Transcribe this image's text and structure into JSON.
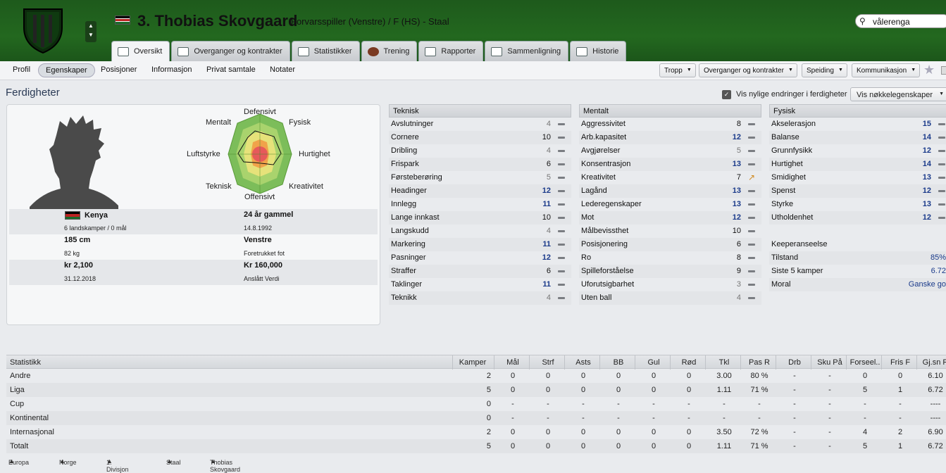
{
  "header": {
    "player_number_name": "3. Thobias Skovgaard",
    "subtitle": "Forvarsspiller (Venstre) / F (HS) - Staal",
    "search_value": "vålerenga"
  },
  "tabs": [
    {
      "label": "Oversikt"
    },
    {
      "label": "Overganger og kontrakter"
    },
    {
      "label": "Statistikker"
    },
    {
      "label": "Trening"
    },
    {
      "label": "Rapporter"
    },
    {
      "label": "Sammenligning"
    },
    {
      "label": "Historie"
    }
  ],
  "subnav": {
    "items": [
      "Profil",
      "Egenskaper",
      "Posisjoner",
      "Informasjon",
      "Privat samtale",
      "Notater"
    ],
    "active": "Egenskaper",
    "dropdowns": [
      "Tropp",
      "Overganger og kontrakter",
      "Speiding",
      "Kommunikasjon"
    ]
  },
  "page_title": "Ferdigheter",
  "show_changes_label": "Vis nylige endringer i ferdigheter",
  "key_attributes_btn": "Vis nøkkelegenskaper",
  "radar_labels": {
    "top": "Defensivt",
    "top_left": "Mentalt",
    "top_right": "Fysisk",
    "left": "Luftstyrke",
    "right": "Hurtighet",
    "bottom_left": "Teknisk",
    "bottom_right": "Kreativitet",
    "bottom": "Offensivt"
  },
  "bio": {
    "nation": "Kenya",
    "caps": "6 landskamper / 0 mål",
    "age": "24 år gammel",
    "dob": "14.8.1992",
    "height": "185 cm",
    "weight": "82 kg",
    "foot": "Venstre",
    "foot_label": "Foretrukket fot",
    "wage": "kr 2,100",
    "contract_end": "31.12.2018",
    "value": "Kr 160,000",
    "value_label": "Anslått Verdi"
  },
  "technical": {
    "title": "Teknisk",
    "items": [
      {
        "name": "Avslutninger",
        "value": "4"
      },
      {
        "name": "Cornere",
        "value": "10"
      },
      {
        "name": "Dribling",
        "value": "4"
      },
      {
        "name": "Frispark",
        "value": "6"
      },
      {
        "name": "Førsteberøring",
        "value": "5"
      },
      {
        "name": "Headinger",
        "value": "12"
      },
      {
        "name": "Innlegg",
        "value": "11"
      },
      {
        "name": "Lange innkast",
        "value": "10"
      },
      {
        "name": "Langskudd",
        "value": "4"
      },
      {
        "name": "Markering",
        "value": "11"
      },
      {
        "name": "Pasninger",
        "value": "12"
      },
      {
        "name": "Straffer",
        "value": "6"
      },
      {
        "name": "Taklinger",
        "value": "11"
      },
      {
        "name": "Teknikk",
        "value": "4"
      }
    ]
  },
  "mental": {
    "title": "Mentalt",
    "items": [
      {
        "name": "Aggressivitet",
        "value": "8"
      },
      {
        "name": "Arb.kapasitet",
        "value": "12"
      },
      {
        "name": "Avgjørelser",
        "value": "5"
      },
      {
        "name": "Konsentrasjon",
        "value": "13"
      },
      {
        "name": "Kreativitet",
        "value": "7"
      },
      {
        "name": "Lagånd",
        "value": "13"
      },
      {
        "name": "Lederegenskaper",
        "value": "13"
      },
      {
        "name": "Mot",
        "value": "12"
      },
      {
        "name": "Målbevissthet",
        "value": "10"
      },
      {
        "name": "Posisjonering",
        "value": "6"
      },
      {
        "name": "Ro",
        "value": "8"
      },
      {
        "name": "Spilleforståelse",
        "value": "9"
      },
      {
        "name": "Uforutsigbarhet",
        "value": "3"
      },
      {
        "name": "Uten ball",
        "value": "4"
      }
    ]
  },
  "physical": {
    "title": "Fysisk",
    "items": [
      {
        "name": "Akselerasjon",
        "value": "15"
      },
      {
        "name": "Balanse",
        "value": "14"
      },
      {
        "name": "Grunnfysikk",
        "value": "12"
      },
      {
        "name": "Hurtighet",
        "value": "14"
      },
      {
        "name": "Smidighet",
        "value": "13"
      },
      {
        "name": "Spenst",
        "value": "12"
      },
      {
        "name": "Styrke",
        "value": "13"
      },
      {
        "name": "Utholdenhet",
        "value": "12"
      }
    ],
    "performance_title": "Keeperanseelse",
    "performance": [
      {
        "name": "Tilstand",
        "value": "85%"
      },
      {
        "name": "Siste 5 kamper",
        "value": "6.72"
      },
      {
        "name": "Moral",
        "value": "Ganske go"
      }
    ]
  },
  "stats": {
    "headers": [
      "Statistikk",
      "Kamper",
      "Mål",
      "Strf",
      "Asts",
      "BB",
      "Gul",
      "Rød",
      "Tkl",
      "Pas R",
      "Drb",
      "Sku På",
      "Forseel..",
      "Fris F",
      "Gj.sn R"
    ],
    "rows": [
      [
        "Andre",
        "2",
        "0",
        "0",
        "0",
        "0",
        "0",
        "0",
        "3.00",
        "80 %",
        "-",
        "-",
        "0",
        "0",
        "6.10"
      ],
      [
        "Liga",
        "5",
        "0",
        "0",
        "0",
        "0",
        "0",
        "0",
        "1.11",
        "71 %",
        "-",
        "-",
        "5",
        "1",
        "6.72"
      ],
      [
        "Cup",
        "0",
        "-",
        "-",
        "-",
        "-",
        "-",
        "-",
        "-",
        "-",
        "-",
        "-",
        "-",
        "-",
        "----"
      ],
      [
        "Kontinental",
        "0",
        "-",
        "-",
        "-",
        "-",
        "-",
        "-",
        "-",
        "-",
        "-",
        "-",
        "-",
        "-",
        "----"
      ],
      [
        "Internasjonal",
        "2",
        "0",
        "0",
        "0",
        "0",
        "0",
        "0",
        "3.50",
        "72 %",
        "-",
        "-",
        "4",
        "2",
        "6.90"
      ],
      [
        "Totalt",
        "5",
        "0",
        "0",
        "0",
        "0",
        "0",
        "0",
        "1.11",
        "71 %",
        "-",
        "-",
        "5",
        "1",
        "6.72"
      ]
    ]
  },
  "footer": [
    "Europa",
    "Norge",
    "1. Divisjon",
    "Staal",
    "Thobias Skovgaard"
  ]
}
